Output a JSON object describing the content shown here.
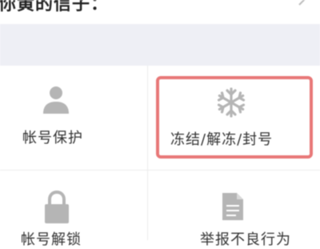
{
  "header": {
    "title": "你黄的信子：",
    "chevron_icon": "chevron-right-icon"
  },
  "grid": {
    "items": [
      {
        "label": "帐号保护",
        "icon": "user-icon"
      },
      {
        "label": "冻结/解冻/封号",
        "icon": "snowflake-icon",
        "highlighted": true
      },
      {
        "label": "帐号解锁",
        "icon": "lock-icon"
      },
      {
        "label": "举报不良行为",
        "icon": "document-icon"
      }
    ]
  },
  "colors": {
    "icon_gray": "#b5b5b5",
    "highlight_border": "#e87878",
    "band_background": "#eeeff5",
    "text": "#333333"
  }
}
